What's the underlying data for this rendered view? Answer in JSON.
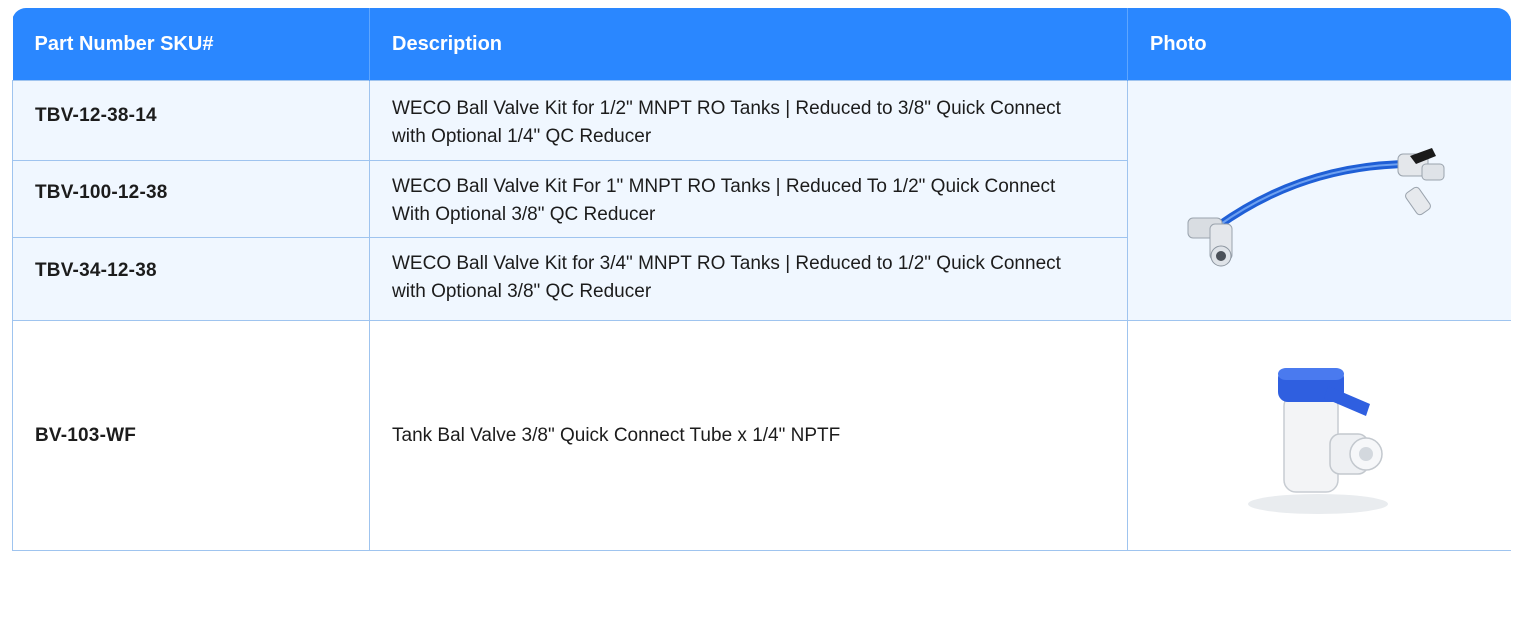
{
  "header": {
    "col_sku": "Part Number SKU#",
    "col_description": "Description",
    "col_photo": "Photo"
  },
  "rows": [
    {
      "sku": "TBV-12-38-14",
      "description": "WECO Ball Valve Kit for 1/2\" MNPT RO Tanks | Reduced to 3/8\" Quick Connect with Optional 1/4\" QC Reducer"
    },
    {
      "sku": "TBV-100-12-38",
      "description": "WECO Ball Valve Kit For 1\" MNPT RO Tanks | Reduced To 1/2\" Quick Connect With Optional 3/8\" QC Reducer"
    },
    {
      "sku": "TBV-34-12-38",
      "description": "WECO Ball Valve Kit for 3/4\" MNPT RO Tanks | Reduced to 1/2\" Quick Connect with Optional 3/8\" QC Reducer"
    },
    {
      "sku": "BV-103-WF",
      "description": "Tank Bal Valve 3/8\" Quick Connect Tube x 1/4\" NPTF"
    }
  ],
  "photos": {
    "kit_icon": "ball-valve-kit-with-blue-tubing-icon",
    "valve_icon": "blue-handle-tank-ball-valve-icon"
  },
  "colors": {
    "header_bg": "#2a87ff",
    "band_bg": "#f0f7ff",
    "border": "#9fc4ef",
    "accent_blue": "#1f5fd6"
  }
}
